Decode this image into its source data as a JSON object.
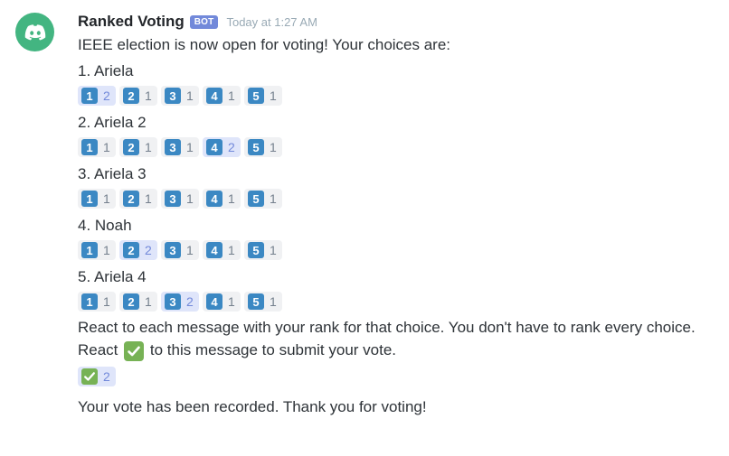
{
  "colors": {
    "accent": "#7289da",
    "avatar": "#43b581",
    "keycap": "#3b88c3",
    "check": "#77b255"
  },
  "message": {
    "author": "Ranked Voting",
    "bot_tag": "BOT",
    "timestamp": "Today at 1:27 AM",
    "intro": "IEEE election is now open for voting! Your choices are:",
    "choices": [
      {
        "title": "1. Ariela",
        "reactions": [
          {
            "key": "1",
            "count": "2",
            "me": true
          },
          {
            "key": "2",
            "count": "1",
            "me": false
          },
          {
            "key": "3",
            "count": "1",
            "me": false
          },
          {
            "key": "4",
            "count": "1",
            "me": false
          },
          {
            "key": "5",
            "count": "1",
            "me": false
          }
        ]
      },
      {
        "title": "2. Ariela 2",
        "reactions": [
          {
            "key": "1",
            "count": "1",
            "me": false
          },
          {
            "key": "2",
            "count": "1",
            "me": false
          },
          {
            "key": "3",
            "count": "1",
            "me": false
          },
          {
            "key": "4",
            "count": "2",
            "me": true
          },
          {
            "key": "5",
            "count": "1",
            "me": false
          }
        ]
      },
      {
        "title": "3. Ariela 3",
        "reactions": [
          {
            "key": "1",
            "count": "1",
            "me": false
          },
          {
            "key": "2",
            "count": "1",
            "me": false
          },
          {
            "key": "3",
            "count": "1",
            "me": false
          },
          {
            "key": "4",
            "count": "1",
            "me": false
          },
          {
            "key": "5",
            "count": "1",
            "me": false
          }
        ]
      },
      {
        "title": "4. Noah",
        "reactions": [
          {
            "key": "1",
            "count": "1",
            "me": false
          },
          {
            "key": "2",
            "count": "2",
            "me": true
          },
          {
            "key": "3",
            "count": "1",
            "me": false
          },
          {
            "key": "4",
            "count": "1",
            "me": false
          },
          {
            "key": "5",
            "count": "1",
            "me": false
          }
        ]
      },
      {
        "title": "5. Ariela 4",
        "reactions": [
          {
            "key": "1",
            "count": "1",
            "me": false
          },
          {
            "key": "2",
            "count": "1",
            "me": false
          },
          {
            "key": "3",
            "count": "2",
            "me": true
          },
          {
            "key": "4",
            "count": "1",
            "me": false
          },
          {
            "key": "5",
            "count": "1",
            "me": false
          }
        ]
      }
    ],
    "instructions": "React to each message with your rank for that choice. You don't have to rank every choice.",
    "submit_prefix": "React",
    "submit_suffix": "to this message to submit your vote.",
    "submit_reaction": {
      "icon": "check-mark-icon",
      "count": "2"
    },
    "followup": "Your vote has been recorded. Thank you for voting!"
  }
}
